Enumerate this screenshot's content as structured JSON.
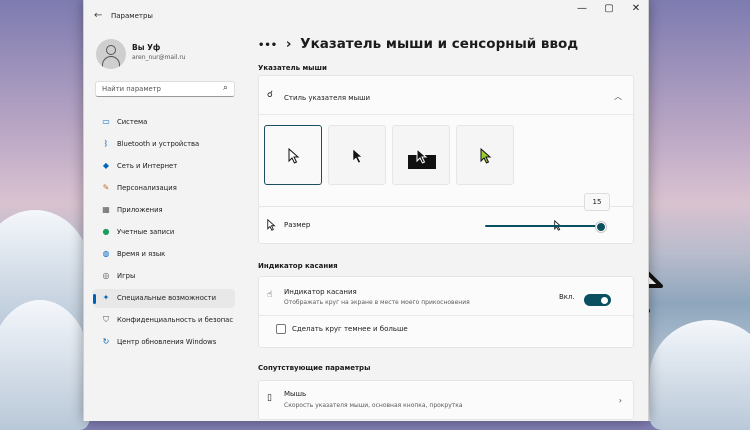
{
  "window": {
    "title": "Параметры",
    "controls": {
      "minimize": "—",
      "maximize": "▢",
      "close": "✕"
    }
  },
  "user": {
    "name": "Вы Уф",
    "email": "aren_nur@mail.ru"
  },
  "search": {
    "placeholder": "Найти параметр",
    "icon": "search-icon"
  },
  "sidebar": {
    "items": [
      {
        "label": "Система",
        "icon": "monitor-icon",
        "color": "#0067c0"
      },
      {
        "label": "Bluetooth и устройства",
        "icon": "bluetooth-icon",
        "color": "#0067c0"
      },
      {
        "label": "Сеть и Интернет",
        "icon": "wifi-icon",
        "color": "#0067c0"
      },
      {
        "label": "Персонализация",
        "icon": "brush-icon",
        "color": "#c46a2b"
      },
      {
        "label": "Приложения",
        "icon": "apps-icon",
        "color": "#555555"
      },
      {
        "label": "Учетные записи",
        "icon": "person-icon",
        "color": "#1a9e5c"
      },
      {
        "label": "Время и язык",
        "icon": "globe-icon",
        "color": "#0067c0"
      },
      {
        "label": "Игры",
        "icon": "gamepad-icon",
        "color": "#555555"
      },
      {
        "label": "Специальные возможности",
        "icon": "accessibility-icon",
        "color": "#0067c0",
        "active": true
      },
      {
        "label": "Конфиденциальность и безопас",
        "icon": "shield-icon",
        "color": "#555555"
      },
      {
        "label": "Центр обновления Windows",
        "icon": "update-icon",
        "color": "#0067c0"
      }
    ]
  },
  "main": {
    "breadcrumb_more": "•••",
    "breadcrumb_sep": "›",
    "page_title": "Указатель мыши и сенсорный ввод",
    "pointer_section": "Указатель мыши",
    "pointer_style": {
      "label": "Стиль указателя мыши",
      "icon": "pointer-style-icon"
    },
    "size": {
      "label": "Размер",
      "value": "15"
    },
    "touch_section": "Индикатор касания",
    "touch_indicator": {
      "label": "Индикатор касания",
      "sublabel": "Отображать круг на экране в месте моего прикосновения",
      "toggle_text": "Вкл."
    },
    "darker_circle": {
      "label": "Сделать круг темнее и больше"
    },
    "related_section": "Сопутствующие параметры",
    "mouse": {
      "label": "Мышь",
      "sublabel": "Скорость указателя мыши, основная кнопка, прокрутка"
    }
  },
  "colors": {
    "accent": "#0b5060",
    "custom_cursor": "#9acd32"
  }
}
